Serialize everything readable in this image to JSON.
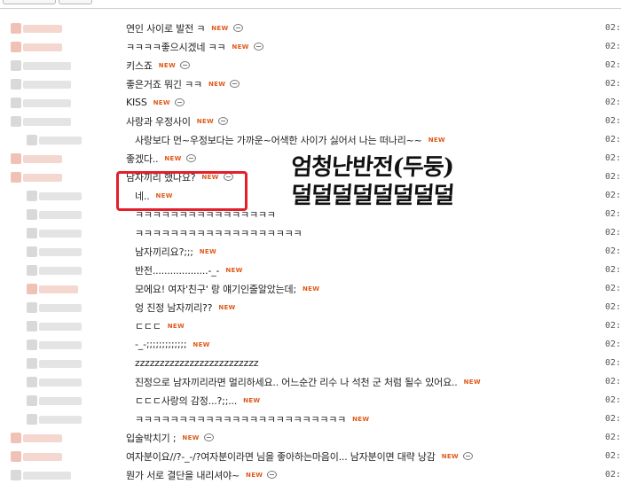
{
  "rows": [
    {
      "text": "연인 사이로 발전 ㅋ",
      "new": "NEW",
      "comment": true,
      "time": "02:5",
      "indent": 0
    },
    {
      "text": "ㅋㅋㅋㅋ좋으시겠네 ㅋㅋ",
      "new": "NEW",
      "comment": true,
      "time": "02:5",
      "indent": 0
    },
    {
      "text": "키스죠",
      "new": "NEW",
      "comment": true,
      "time": "02:5",
      "indent": 0
    },
    {
      "text": "좋은거죠 뭐긴 ㅋㅋ",
      "new": "NEW",
      "comment": true,
      "time": "02:5",
      "indent": 0
    },
    {
      "text": "KISS",
      "new": "NEW",
      "comment": true,
      "time": "02:5",
      "indent": 0
    },
    {
      "text": "사랑과 우정사이",
      "new": "NEW",
      "comment": true,
      "time": "02:5",
      "indent": 0
    },
    {
      "text": "사랑보다 먼~우정보다는 가까운~어색한 사이가 싫어서 나는 떠나리~~",
      "new": "NEW",
      "comment": false,
      "time": "02:5",
      "indent": 1
    },
    {
      "text": "좋겠다..",
      "new": "NEW",
      "comment": true,
      "time": "02:5",
      "indent": 0
    },
    {
      "text": "남자끼리 했나요?",
      "new": "NEW",
      "comment": true,
      "time": "02:5",
      "indent": 0
    },
    {
      "text": "네..",
      "new": "NEW",
      "comment": false,
      "time": "02:5",
      "indent": 1
    },
    {
      "text": "ㅋㅋㅋㅋㅋㅋㅋㅋㅋㅋㅋㅋㅋㅋㅋㅋ",
      "new": "",
      "comment": false,
      "time": "02:5",
      "indent": 1
    },
    {
      "text": "ㅋㅋㅋㅋㅋㅋㅋㅋㅋㅋㅋㅋㅋㅋㅋㅋㅋㅋㅋ",
      "new": "",
      "comment": false,
      "time": "02:5",
      "indent": 1
    },
    {
      "text": "남자끼리요?;;;",
      "new": "NEW",
      "comment": false,
      "time": "02:5",
      "indent": 1
    },
    {
      "text": "반전...................-_-",
      "new": "NEW",
      "comment": false,
      "time": "02:5",
      "indent": 1
    },
    {
      "text": "모에요! 여자'친구' 랑 얘기인줄알았는데;",
      "new": "NEW",
      "comment": false,
      "time": "02:5",
      "indent": 1
    },
    {
      "text": "엉 진정 남자끼리??",
      "new": "NEW",
      "comment": false,
      "time": "02:5",
      "indent": 1
    },
    {
      "text": "ㄷㄷㄷ",
      "new": "NEW",
      "comment": false,
      "time": "02:5",
      "indent": 1
    },
    {
      "text": "-_-;;;;;;;;;;;;;",
      "new": "NEW",
      "comment": false,
      "time": "02:5",
      "indent": 1
    },
    {
      "text": "zzzzzzzzzzzzzzzzzzzzzzzzz",
      "new": "",
      "comment": false,
      "time": "02:5",
      "indent": 1
    },
    {
      "text": "진정으로 남자끼리라면 멀리하세요.. 어느순간 리수 나 석천 군 처럼 될수 있어요..",
      "new": "NEW",
      "comment": false,
      "time": "02:5",
      "indent": 1
    },
    {
      "text": "ㄷㄷㄷ사랑의 감정...?;;...",
      "new": "NEW",
      "comment": false,
      "time": "02:5",
      "indent": 1
    },
    {
      "text": "ㅋㅋㅋㅋㅋㅋㅋㅋㅋㅋㅋㅋㅋㅋㅋㅋㅋㅋㅋㅋㅋㅋㅋㅋ",
      "new": "NEW",
      "comment": false,
      "time": "02:5",
      "indent": 1
    },
    {
      "text": "입술박치기 ;",
      "new": "NEW",
      "comment": true,
      "time": "02:5",
      "indent": 0
    },
    {
      "text": "여자분이요//?-_-/?여자분이라면 님을 좋아하는마음이... 남자분이면 대략 낭감",
      "new": "NEW",
      "comment": true,
      "time": "02:5",
      "indent": 0
    },
    {
      "text": "뭔가 서로 결단을 내리셔야~",
      "new": "NEW",
      "comment": true,
      "time": "02:5",
      "indent": 0
    }
  ],
  "overlay": {
    "line1": "엄청난반전(두둥)",
    "line2": "덜덜덜덜덜덜덜덜"
  },
  "colors": {
    "new_tag": "#e05a1a",
    "highlight_box": "#e3202a",
    "blur_pink": "#f3cfc4",
    "blur_gray": "#dcdcdc"
  }
}
